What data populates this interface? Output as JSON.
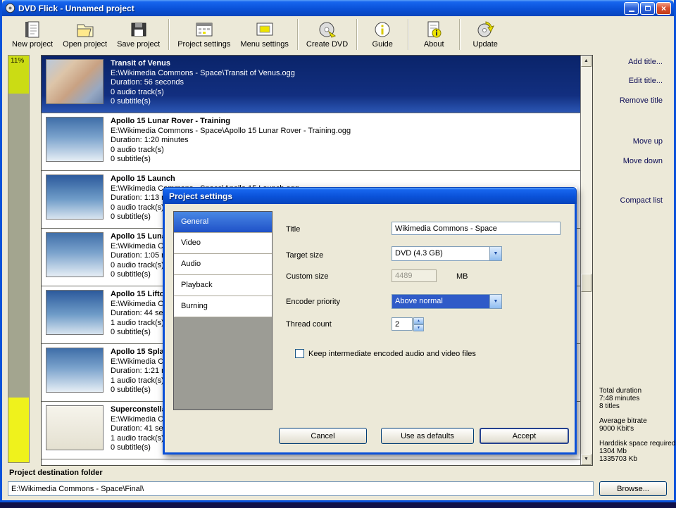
{
  "window": {
    "title": "DVD Flick - Unnamed project"
  },
  "toolbar": {
    "items": [
      "New project",
      "Open project",
      "Save project",
      "Project settings",
      "Menu settings",
      "Create DVD",
      "Guide",
      "About",
      "Update"
    ]
  },
  "meter": {
    "percent": "11%"
  },
  "list": {
    "titles": [
      {
        "name": "Transit of Venus",
        "path": "E:\\Wikimedia Commons - Space\\Transit of Venus.ogg",
        "duration": "Duration: 56 seconds",
        "audio": "0 audio track(s)",
        "subs": "0 subtitle(s)"
      },
      {
        "name": "Apollo 15 Lunar Rover - Training",
        "path": "E:\\Wikimedia Commons - Space\\Apollo 15 Lunar Rover - Training.ogg",
        "duration": "Duration: 1:20 minutes",
        "audio": "0 audio track(s)",
        "subs": "0 subtitle(s)"
      },
      {
        "name": "Apollo 15 Launch",
        "path": "E:\\Wikimedia Commons - Space\\Apollo 15 Launch.ogg",
        "duration": "Duration: 1:13 minutes",
        "audio": "0 audio track(s)",
        "subs": "0 subtitle(s)"
      },
      {
        "name": "Apollo 15 Lunar Rover",
        "path": "E:\\Wikimedia Commons - Space\\Apollo 15 Lunar Rover.ogg",
        "duration": "Duration: 1:05 minutes",
        "audio": "0 audio track(s)",
        "subs": "0 subtitle(s)"
      },
      {
        "name": "Apollo 15 Liftoff",
        "path": "E:\\Wikimedia Commons - Space\\Apollo 15 Liftoff.ogg",
        "duration": "Duration: 44 seconds",
        "audio": "1 audio track(s)",
        "subs": "0 subtitle(s)"
      },
      {
        "name": "Apollo 15 Splashdown",
        "path": "E:\\Wikimedia Commons - Space\\Apollo 15 Splashdown.ogg",
        "duration": "Duration: 1:21 minutes",
        "audio": "1 audio track(s)",
        "subs": "0 subtitle(s)"
      },
      {
        "name": "Superconstellation",
        "path": "E:\\Wikimedia Commons - Space\\Superconstellation.ogg",
        "duration": "Duration: 41 seconds",
        "audio": "1 audio track(s)",
        "subs": "0 subtitle(s)"
      }
    ]
  },
  "side": {
    "buttons": [
      "Add title...",
      "Edit title...",
      "Remove title",
      "Move up",
      "Move down",
      "Compact list"
    ]
  },
  "summary": {
    "total_label": "Total duration",
    "total_value": "7:48 minutes",
    "titles_count": "8 titles",
    "bitrate_label": "Average bitrate",
    "bitrate_value": "9000 Kbit's",
    "space_label": "Harddisk space required",
    "space_mb": "1304 Mb",
    "space_kb": "1335703 Kb"
  },
  "footer": {
    "label": "Project destination folder",
    "path": "E:\\Wikimedia Commons - Space\\Final\\",
    "browse": "Browse..."
  },
  "dialog": {
    "title": "Project settings",
    "tabs": [
      "General",
      "Video",
      "Audio",
      "Playback",
      "Burning"
    ],
    "fields": {
      "title_label": "Title",
      "title_value": "Wikimedia Commons - Space",
      "target_label": "Target size",
      "target_value": "DVD (4.3 GB)",
      "custom_label": "Custom size",
      "custom_value": "4489",
      "custom_unit": "MB",
      "encoder_label": "Encoder priority",
      "encoder_value": "Above normal",
      "thread_label": "Thread count",
      "thread_value": "2",
      "checkbox_label": "Keep intermediate encoded audio and video files"
    },
    "buttons": {
      "cancel": "Cancel",
      "defaults": "Use as defaults",
      "accept": "Accept"
    }
  },
  "colors": {
    "titlebar_blue": "#0A51D8",
    "selection_navy": "#0A246A",
    "beige": "#ECE9D8",
    "meter_yellow": "#EFF21C",
    "meter_green": "#CBDC14"
  }
}
